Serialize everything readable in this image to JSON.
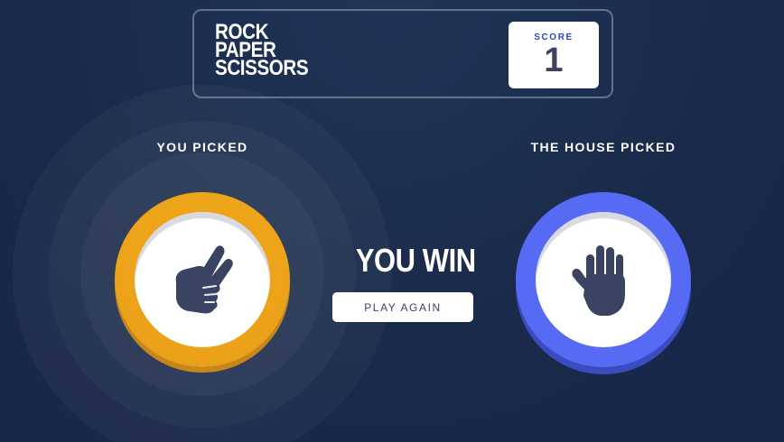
{
  "header": {
    "logo_lines": [
      "ROCK",
      "PAPER",
      "SCISSORS"
    ],
    "score_label": "SCORE",
    "score_value": "1"
  },
  "player": {
    "label": "YOU PICKED",
    "choice": "scissors",
    "icon": "scissors-hand-icon",
    "color": "#eba21a"
  },
  "house": {
    "label": "THE HOUSE PICKED",
    "choice": "paper",
    "icon": "paper-hand-icon",
    "color": "#566af3"
  },
  "result": {
    "text": "YOU WIN",
    "button_label": "PLAY AGAIN",
    "winner": "player"
  },
  "colors": {
    "background": "#1a2a4a",
    "icon_fill": "#3b4363",
    "score_label": "#2a46c0"
  }
}
